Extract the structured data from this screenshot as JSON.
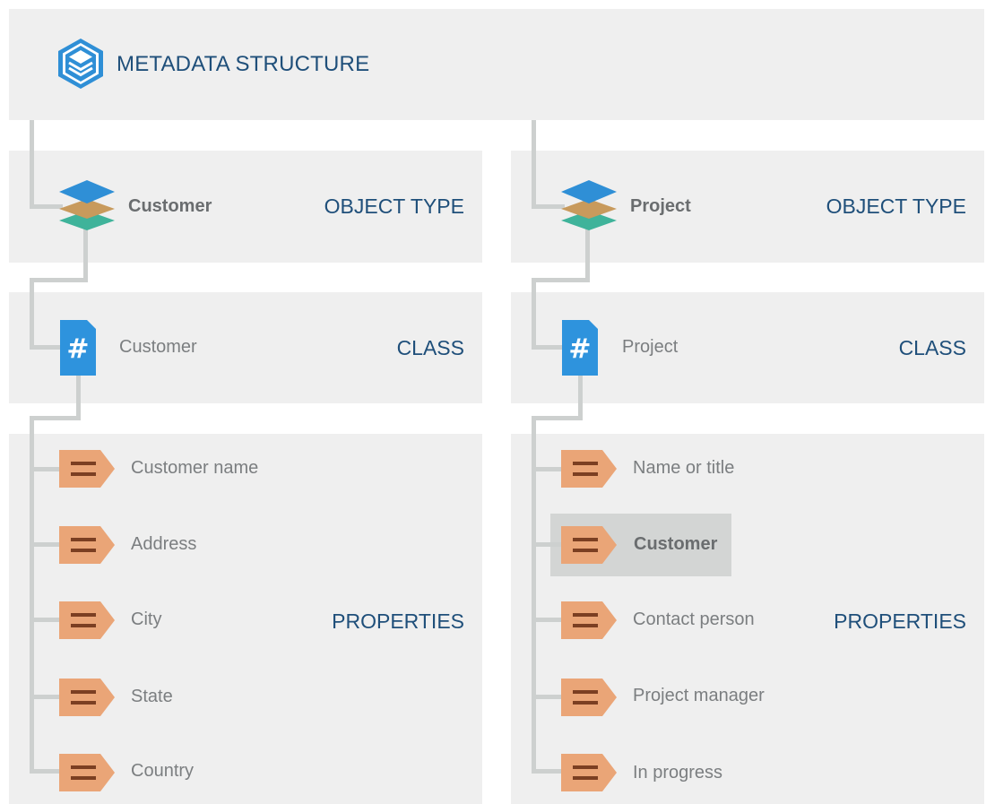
{
  "header": {
    "title": "METADATA STRUCTURE",
    "icon": "vault-layers-icon"
  },
  "colors": {
    "panel": "#efefef",
    "connector": "#cdd0cf",
    "label": "#1f4f7a",
    "object_type_top": "#2f8fd6",
    "object_type_middle": "#c89a5c",
    "object_type_bottom": "#3fb39a",
    "class_icon": "#2e93dd",
    "property_icon": "#eaa577",
    "highlight": "#d3d5d4"
  },
  "levels": {
    "object_type": "OBJECT TYPE",
    "class": "CLASS",
    "properties": "PROPERTIES"
  },
  "columns": [
    {
      "object_type": "Customer",
      "class": "Customer",
      "properties": [
        {
          "label": "Customer name"
        },
        {
          "label": "Address"
        },
        {
          "label": "City"
        },
        {
          "label": "State"
        },
        {
          "label": "Country"
        }
      ]
    },
    {
      "object_type": "Project",
      "class": "Project",
      "properties": [
        {
          "label": "Name or title"
        },
        {
          "label": "Customer",
          "highlighted": true
        },
        {
          "label": "Contact person"
        },
        {
          "label": "Project manager"
        },
        {
          "label": "In progress"
        }
      ]
    }
  ]
}
